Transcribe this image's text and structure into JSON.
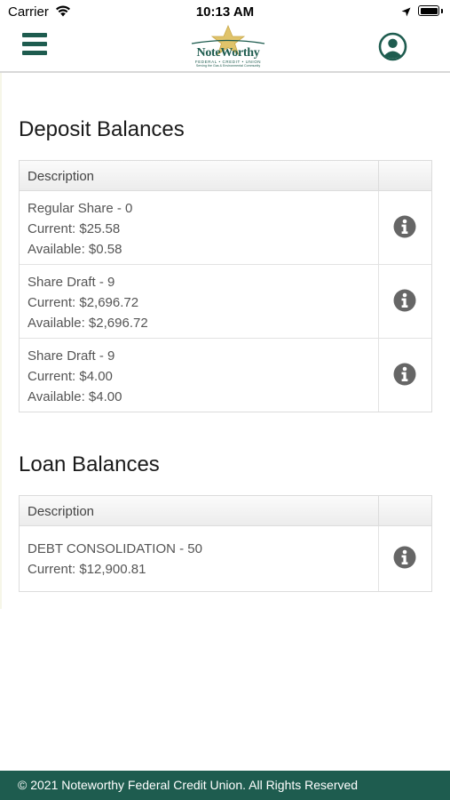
{
  "status_bar": {
    "carrier": "Carrier",
    "time": "10:13 AM",
    "battery_level": 1.0
  },
  "header": {
    "logo_name": "NoteWorthy",
    "logo_subtitle": "FEDERAL • CREDIT • UNION",
    "logo_tagline": "Serving the Gas & Environmental Community",
    "menu_icon": "hamburger-menu-icon",
    "profile_icon": "user-profile-icon",
    "brand_color": "#1e5c4f"
  },
  "deposit": {
    "title": "Deposit Balances",
    "column_header": "Description",
    "rows": [
      {
        "name": "Regular Share - 0",
        "current": "Current: $25.58",
        "available": "Available: $0.58"
      },
      {
        "name": "Share Draft - 9",
        "current": "Current: $2,696.72",
        "available": "Available: $2,696.72"
      },
      {
        "name": "Share Draft - 9",
        "current": "Current: $4.00",
        "available": "Available: $4.00"
      }
    ]
  },
  "loan": {
    "title": "Loan Balances",
    "column_header": "Description",
    "rows": [
      {
        "name": "DEBT CONSOLIDATION - 50",
        "current": "Current: $12,900.81"
      }
    ]
  },
  "footer": {
    "text": "© 2021 Noteworthy Federal Credit Union. All Rights Reserved"
  },
  "colors": {
    "info_icon": "#666666",
    "footer_bg": "#1e5c4f"
  }
}
